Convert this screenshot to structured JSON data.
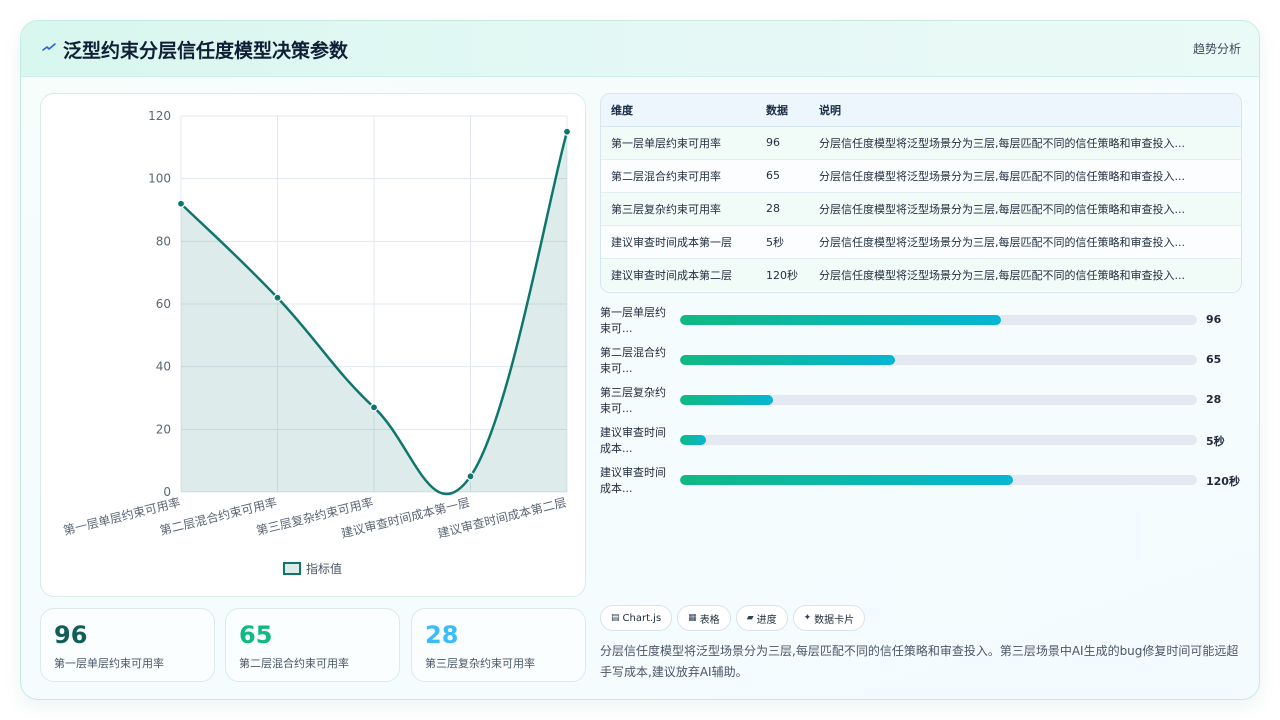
{
  "header": {
    "title": "泛型约束分层信任度模型决策参数",
    "link": "趋势分析",
    "icon": "spark-icon"
  },
  "chart_data": {
    "type": "line",
    "categories": [
      "第一层单层约束可用率",
      "第二层混合约束可用率",
      "第三层复杂约束可用率",
      "建议审查时间成本第一层",
      "建议审查时间成本第二层"
    ],
    "series": [
      {
        "name": "指标值",
        "values": [
          92,
          62,
          27,
          5,
          115
        ],
        "color": "#0f766e"
      }
    ],
    "ylim": [
      0,
      120
    ],
    "yticks": [
      "0",
      "20",
      "40",
      "60",
      "80",
      "100",
      "120"
    ],
    "grid": true,
    "legend": "bottom"
  },
  "stats": [
    {
      "value": "96",
      "label": "第一层单层约束可用率",
      "color": "#115e59"
    },
    {
      "value": "65",
      "label": "第二层混合约束可用率",
      "color": "#10b981"
    },
    {
      "value": "28",
      "label": "第三层复杂约束可用率",
      "color": "#38bdf8"
    }
  ],
  "table": {
    "headers": [
      "维度",
      "数据",
      "说明"
    ],
    "rows": [
      {
        "dim": "第一层单层约束可用率",
        "val": "96",
        "desc": "分层信任度模型将泛型场景分为三层,每层匹配不同的信任策略和审查投入..."
      },
      {
        "dim": "第二层混合约束可用率",
        "val": "65",
        "desc": "分层信任度模型将泛型场景分为三层,每层匹配不同的信任策略和审查投入..."
      },
      {
        "dim": "第三层复杂约束可用率",
        "val": "28",
        "desc": "分层信任度模型将泛型场景分为三层,每层匹配不同的信任策略和审查投入..."
      },
      {
        "dim": "建议审查时间成本第一层",
        "val": "5秒",
        "desc": "分层信任度模型将泛型场景分为三层,每层匹配不同的信任策略和审查投入..."
      },
      {
        "dim": "建议审查时间成本第二层",
        "val": "120秒",
        "desc": "分层信任度模型将泛型场景分为三层,每层匹配不同的信任策略和审查投入..."
      }
    ]
  },
  "progress": [
    {
      "label1": "第一层单层约",
      "label2": "束可...",
      "value": "96",
      "fraction": 0.62
    },
    {
      "label1": "第二层混合约",
      "label2": "束可...",
      "value": "65",
      "fraction": 0.415
    },
    {
      "label1": "第三层复杂约",
      "label2": "束可...",
      "value": "28",
      "fraction": 0.18
    },
    {
      "label1": "建议审查时间",
      "label2": "成本...",
      "value": "5秒",
      "fraction": 0.05
    },
    {
      "label1": "建议审查时间",
      "label2": "成本...",
      "value": "120秒",
      "fraction": 0.645
    }
  ],
  "chips": [
    {
      "icon": "chart-icon",
      "glyph": "▤",
      "label": "Chart.js"
    },
    {
      "icon": "table-icon",
      "glyph": "▦",
      "label": "表格"
    },
    {
      "icon": "progress-icon",
      "glyph": "▰",
      "label": "进度"
    },
    {
      "icon": "card-icon",
      "glyph": "✦",
      "label": "数据卡片"
    }
  ],
  "description": "分层信任度模型将泛型场景分为三层,每层匹配不同的信任策略和审查投入。第三层场景中AI生成的bug修复时间可能远超手写成本,建议放弃AI辅助。"
}
